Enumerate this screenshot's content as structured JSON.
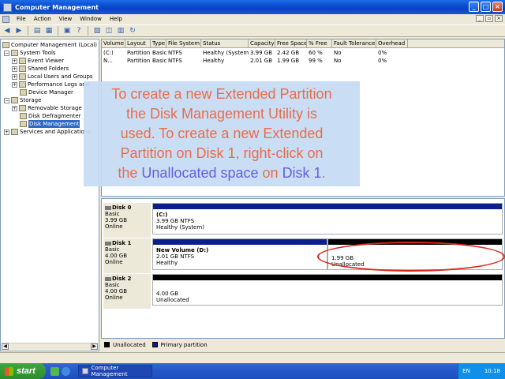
{
  "window": {
    "title": "Computer Management",
    "min": "_",
    "max": "□",
    "close": "×"
  },
  "menu": [
    "File",
    "Action",
    "View",
    "Window",
    "Help"
  ],
  "tree": {
    "items": [
      {
        "label": "Computer Management (Local)",
        "icon": "computer-icon"
      },
      {
        "label": "System Tools",
        "icon": "tools-icon"
      },
      {
        "label": "Event Viewer",
        "icon": "event-viewer-icon"
      },
      {
        "label": "Shared Folders",
        "icon": "folder-icon"
      },
      {
        "label": "Local Users and Groups",
        "icon": "users-icon"
      },
      {
        "label": "Performance Logs and",
        "icon": "performance-icon"
      },
      {
        "label": "Device Manager",
        "icon": "device-icon"
      },
      {
        "label": "Storage",
        "icon": "storage-icon"
      },
      {
        "label": "Removable Storage",
        "icon": "removable-icon"
      },
      {
        "label": "Disk Defragmenter",
        "icon": "defrag-icon"
      },
      {
        "label": "Disk Management",
        "icon": "disk-icon"
      },
      {
        "label": "Services and Applications",
        "icon": "services-icon"
      }
    ]
  },
  "volumes": {
    "columns": [
      "Volume",
      "Layout",
      "Type",
      "File System",
      "Status",
      "Capacity",
      "Free Space",
      "% Free",
      "Fault Tolerance",
      "Overhead"
    ],
    "rows": [
      [
        "(C:)",
        "Partition",
        "Basic",
        "NTFS",
        "Healthy (System)",
        "3.99 GB",
        "2.42 GB",
        "60 %",
        "No",
        "0%"
      ],
      [
        "N...",
        "Partition",
        "Basic",
        "NTFS",
        "Healthy",
        "2.01 GB",
        "1.99 GB",
        "99 %",
        "No",
        "0%"
      ]
    ]
  },
  "overlay": {
    "line1": "To create a new Extended Partition",
    "line2": "the Disk Management Utility is",
    "line3": "used. To create a new Extended",
    "line4": "Partition on Disk 1, right-click on",
    "line5a": "the ",
    "line5b": "Unallocated space",
    "line5c": " on ",
    "line5d": "Disk 1",
    "line5e": "."
  },
  "disks": [
    {
      "name": "Disk 0",
      "type": "Basic",
      "size": "3.99 GB",
      "state": "Online",
      "parts": [
        {
          "title": "(C:)",
          "size": "3.99 GB NTFS",
          "status": "Healthy (System)"
        }
      ]
    },
    {
      "name": "Disk 1",
      "type": "Basic",
      "size": "4.00 GB",
      "state": "Online",
      "parts": [
        {
          "title": "New Volume  (D:)",
          "size": "2.01 GB NTFS",
          "status": "Healthy"
        },
        {
          "title": "",
          "size": "1.99 GB",
          "status": "Unallocated"
        }
      ]
    },
    {
      "name": "Disk 2",
      "type": "Basic",
      "size": "4.00 GB",
      "state": "Online",
      "parts": [
        {
          "title": "",
          "size": "4.00 GB",
          "status": "Unallocated"
        }
      ]
    }
  ],
  "legend": {
    "unallocated": "Unallocated",
    "primary": "Primary partition"
  },
  "colors": {
    "primary": "#0a1e8c",
    "unallocated": "#000000",
    "overlay_text": "#e8603c",
    "overlay_highlight": "#5a53d8",
    "annotation": "#d9261c"
  },
  "taskbar": {
    "start": "start",
    "task": "Computer Management",
    "lang": "EN",
    "clock": "10:18"
  }
}
